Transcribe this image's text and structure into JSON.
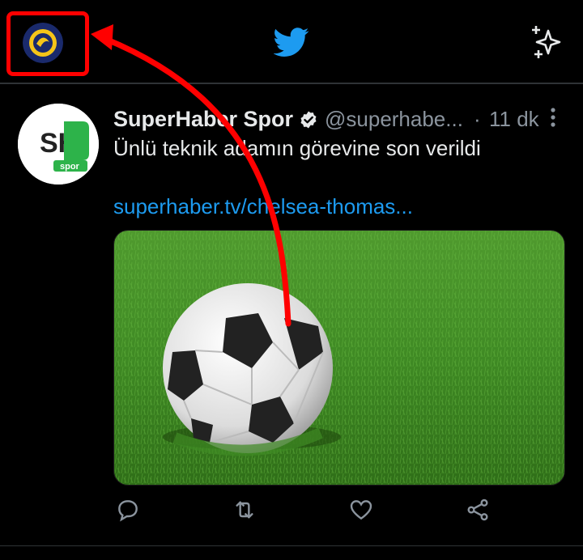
{
  "topbar": {
    "profile_icon": "profile-avatar-icon",
    "logo_icon": "twitter-bird-icon",
    "sparkle_icon": "sparkle-icon",
    "logo_color": "#1d9bf0"
  },
  "tweet": {
    "avatar_text_top": "SH",
    "avatar_text_bottom": "spor",
    "display_name": "SuperHaber Spor",
    "verified_icon": "verified-badge-icon",
    "handle": "@superhabe...",
    "separator": "·",
    "time": "11 dk",
    "text": "Ünlü teknik adamın görevine son verildi",
    "link": "superhaber.tv/chelsea-thomas...",
    "media_icon": "soccer-ball-on-grass-image",
    "link_color": "#1d9bf0",
    "actions": [
      "reply-icon",
      "retweet-icon",
      "like-icon",
      "share-icon"
    ]
  },
  "annotation": {
    "box_color": "#ff0000",
    "arrow_color": "#ff0000"
  }
}
